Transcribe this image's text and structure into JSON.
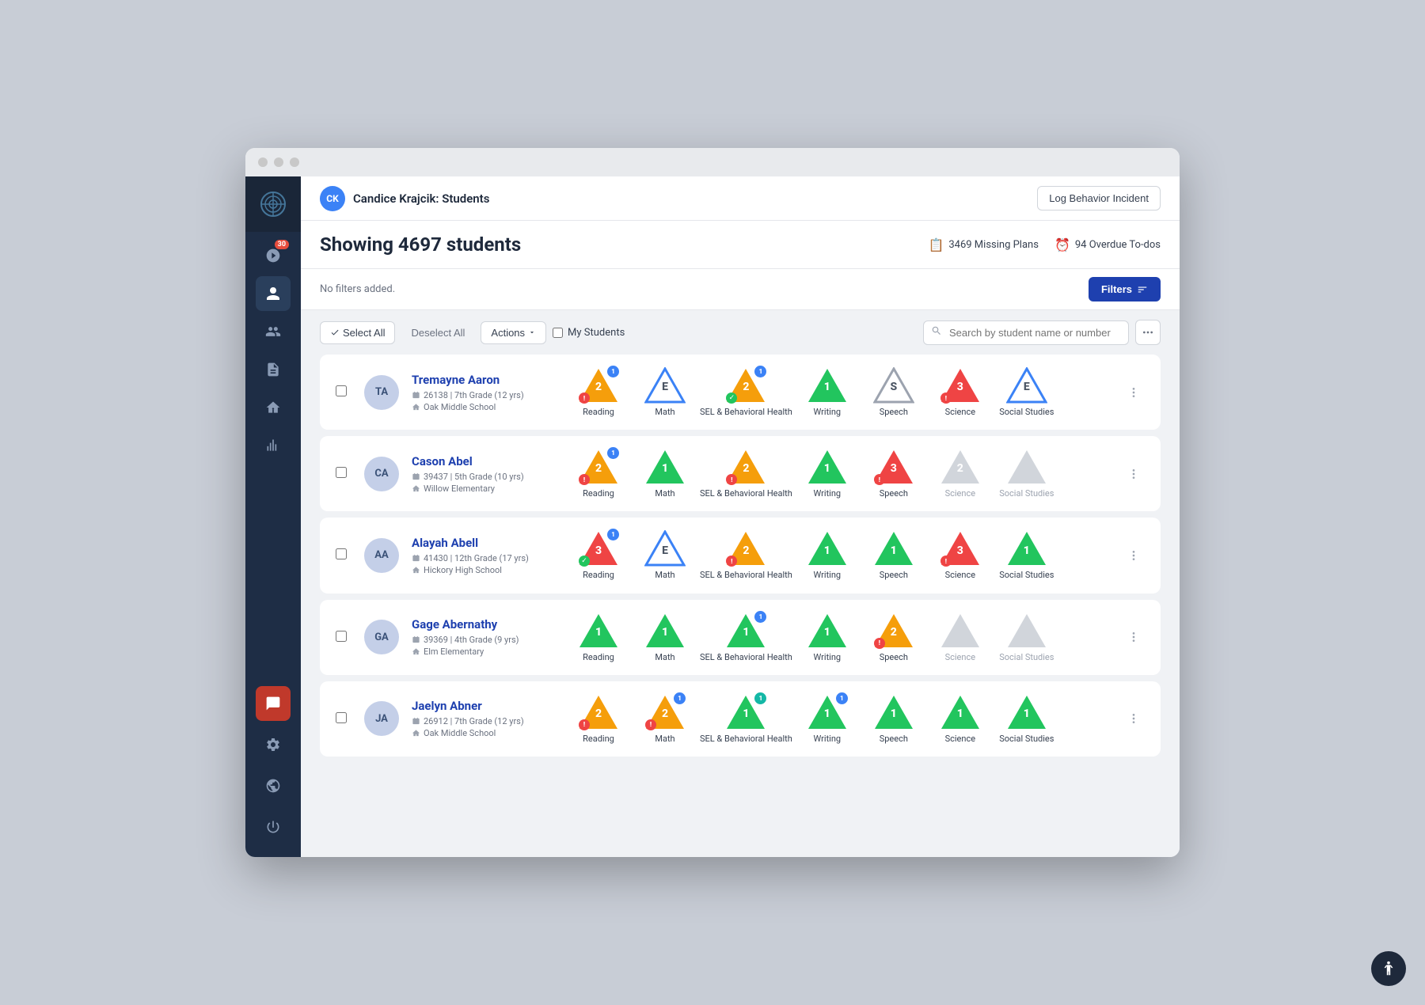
{
  "window": {
    "title": "Candice Krajcik: Students"
  },
  "topbar": {
    "avatar": "CK",
    "username": "Candice Krajcik",
    "page": "Students",
    "title_full": "Candice Krajcik: Students",
    "log_behavior_label": "Log Behavior Incident"
  },
  "page": {
    "showing_label": "Showing 4697 students",
    "missing_plans_count": "3469 Missing Plans",
    "overdue_todos_count": "94 Overdue To-dos",
    "no_filters_label": "No filters added.",
    "filters_button": "Filters"
  },
  "controls": {
    "select_all": "Select All",
    "deselect_all": "Deselect All",
    "actions": "Actions",
    "my_students": "My Students",
    "search_placeholder": "Search by student name or number"
  },
  "sidebar": {
    "notification_badge": "30",
    "items": [
      {
        "name": "home",
        "icon": "⊕",
        "active": false
      },
      {
        "name": "notifications",
        "icon": "🔔",
        "active": false,
        "badge": "30"
      },
      {
        "name": "students",
        "icon": "👤",
        "active": true
      },
      {
        "name": "groups",
        "icon": "👥",
        "active": false
      },
      {
        "name": "documents",
        "icon": "📄",
        "active": false
      },
      {
        "name": "buildings",
        "icon": "🏫",
        "active": false
      },
      {
        "name": "analytics",
        "icon": "📊",
        "active": false
      }
    ],
    "bottom": [
      {
        "name": "chat",
        "icon": "💬"
      },
      {
        "name": "settings",
        "icon": "⚙"
      },
      {
        "name": "globe",
        "icon": "🌐"
      },
      {
        "name": "power",
        "icon": "⏻"
      }
    ]
  },
  "students": [
    {
      "initials": "TA",
      "name": "Tremayne Aaron",
      "id": "26138",
      "grade": "7th Grade (12 yrs)",
      "school": "Oak Middle School",
      "subjects": [
        {
          "label": "Reading",
          "color": "yellow",
          "num": "2",
          "badge": "1",
          "badge_color": "blue",
          "alert": true
        },
        {
          "label": "Math",
          "color": "outline",
          "num": "E",
          "badge": null,
          "alert": false
        },
        {
          "label": "SEL & Behavioral Health",
          "color": "yellow",
          "num": "2",
          "badge": "1",
          "badge_color": "blue",
          "check": true
        },
        {
          "label": "Writing",
          "color": "green",
          "num": "1",
          "badge": null,
          "alert": false
        },
        {
          "label": "Speech",
          "color": "outline_gray",
          "num": "S",
          "badge": null,
          "alert": false
        },
        {
          "label": "Science",
          "color": "red",
          "num": "3",
          "badge": null,
          "alert": true
        },
        {
          "label": "Social Studies",
          "color": "outline",
          "num": "E",
          "badge": null,
          "alert": false
        }
      ]
    },
    {
      "initials": "CA",
      "name": "Cason Abel",
      "id": "39437",
      "grade": "5th Grade (10 yrs)",
      "school": "Willow Elementary",
      "subjects": [
        {
          "label": "Reading",
          "color": "yellow",
          "num": "2",
          "badge": "1",
          "badge_color": "blue",
          "alert": true
        },
        {
          "label": "Math",
          "color": "green",
          "num": "1",
          "badge": null,
          "alert": false
        },
        {
          "label": "SEL & Behavioral Health",
          "color": "yellow",
          "num": "2",
          "badge": null,
          "alert": true
        },
        {
          "label": "Writing",
          "color": "green",
          "num": "1",
          "badge": null,
          "alert": false
        },
        {
          "label": "Speech",
          "color": "red",
          "num": "3",
          "badge": null,
          "alert": true
        },
        {
          "label": "Science",
          "color": "gray",
          "num": "2",
          "badge": null,
          "alert": false,
          "faded": true
        },
        {
          "label": "Social Studies",
          "color": "gray",
          "num": "",
          "badge": null,
          "alert": false,
          "faded": true
        }
      ]
    },
    {
      "initials": "AA",
      "name": "Alayah Abell",
      "id": "41430",
      "grade": "12th Grade (17 yrs)",
      "school": "Hickory High School",
      "subjects": [
        {
          "label": "Reading",
          "color": "red",
          "num": "3",
          "badge": "1",
          "badge_color": "blue",
          "check": true
        },
        {
          "label": "Math",
          "color": "outline",
          "num": "E",
          "badge": null,
          "alert": false
        },
        {
          "label": "SEL & Behavioral Health",
          "color": "yellow",
          "num": "2",
          "badge": null,
          "alert": true
        },
        {
          "label": "Writing",
          "color": "green",
          "num": "1",
          "badge": null,
          "alert": false
        },
        {
          "label": "Speech",
          "color": "green",
          "num": "1",
          "badge": null,
          "alert": false
        },
        {
          "label": "Science",
          "color": "red",
          "num": "3",
          "badge": null,
          "alert": true
        },
        {
          "label": "Social Studies",
          "color": "green",
          "num": "1",
          "badge": null,
          "alert": false
        }
      ]
    },
    {
      "initials": "GA",
      "name": "Gage Abernathy",
      "id": "39369",
      "grade": "4th Grade (9 yrs)",
      "school": "Elm Elementary",
      "subjects": [
        {
          "label": "Reading",
          "color": "green",
          "num": "1",
          "badge": null,
          "alert": false
        },
        {
          "label": "Math",
          "color": "green",
          "num": "1",
          "badge": null,
          "alert": false
        },
        {
          "label": "SEL & Behavioral Health",
          "color": "green",
          "num": "1",
          "badge": "1",
          "badge_color": "blue",
          "alert": false
        },
        {
          "label": "Writing",
          "color": "green",
          "num": "1",
          "badge": null,
          "alert": false
        },
        {
          "label": "Speech",
          "color": "yellow",
          "num": "2",
          "badge": null,
          "alert": true
        },
        {
          "label": "Science",
          "color": "gray",
          "num": "",
          "badge": null,
          "alert": false,
          "faded": true
        },
        {
          "label": "Social Studies",
          "color": "gray",
          "num": "",
          "badge": null,
          "alert": false,
          "faded": true
        }
      ]
    },
    {
      "initials": "JA",
      "name": "Jaelyn Abner",
      "id": "26912",
      "grade": "7th Grade (12 yrs)",
      "school": "Oak Middle School",
      "subjects": [
        {
          "label": "Reading",
          "color": "yellow",
          "num": "2",
          "badge": null,
          "alert": true
        },
        {
          "label": "Math",
          "color": "yellow",
          "num": "2",
          "badge": "1",
          "badge_color": "blue",
          "alert": true
        },
        {
          "label": "SEL & Behavioral Health",
          "color": "green",
          "num": "1",
          "badge": "1",
          "badge_color": "teal",
          "alert": false
        },
        {
          "label": "Writing",
          "color": "green",
          "num": "1",
          "badge": "1",
          "badge_color": "blue",
          "alert": false
        },
        {
          "label": "Speech",
          "color": "green",
          "num": "1",
          "badge": null,
          "alert": false
        },
        {
          "label": "Science",
          "color": "green",
          "num": "1",
          "badge": null,
          "alert": false
        },
        {
          "label": "Social Studies",
          "color": "green",
          "num": "1",
          "badge": null,
          "alert": false
        }
      ]
    }
  ],
  "accessibility_label": "♿"
}
